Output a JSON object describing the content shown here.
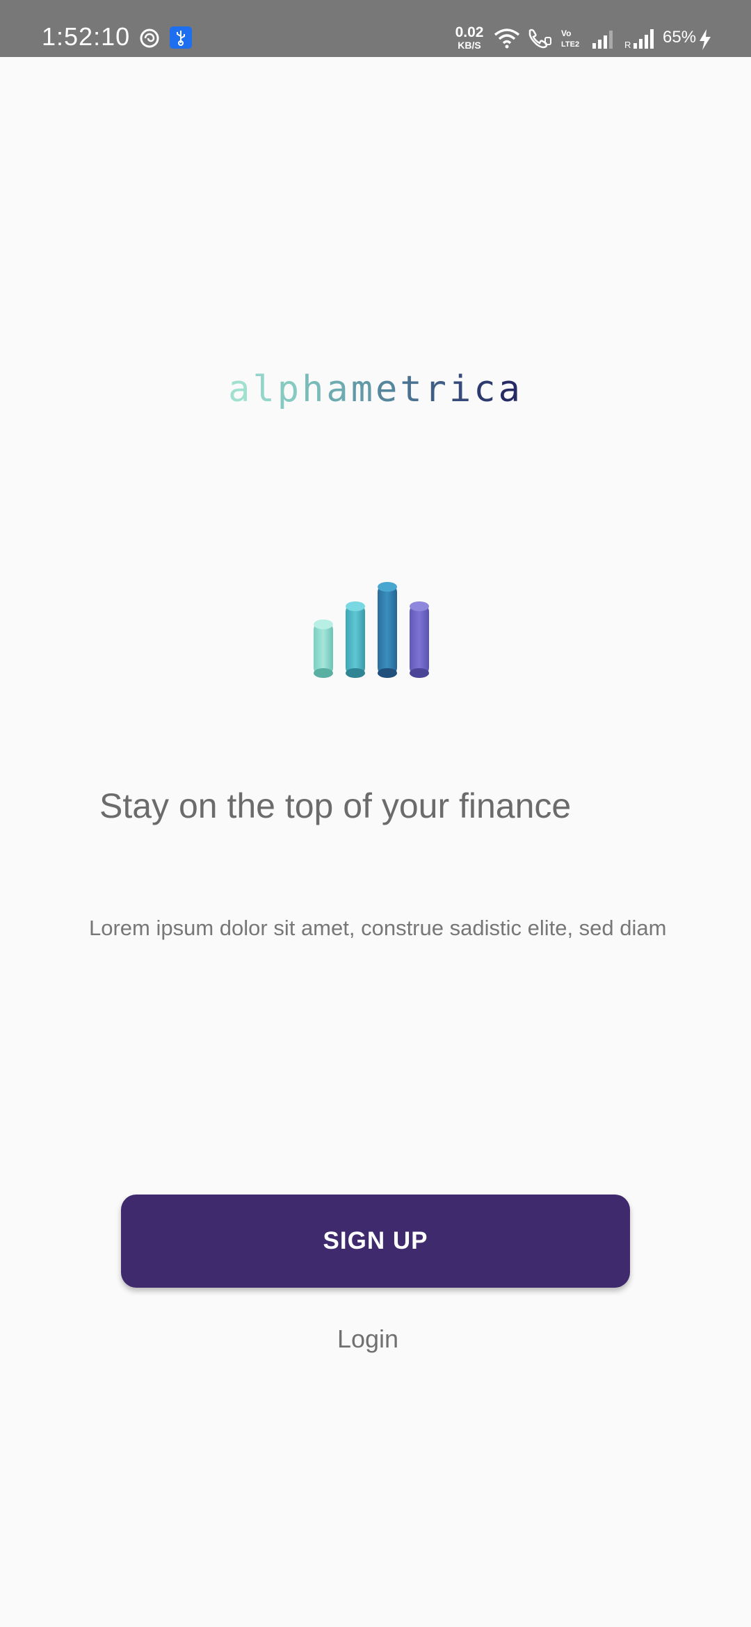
{
  "status_bar": {
    "time": "1:52:10",
    "net_speed_value": "0.02",
    "net_speed_unit": "KB/S",
    "battery_percent": "65%",
    "icons": [
      "sync-app-icon",
      "usb-icon",
      "wifi-icon",
      "wifi-calling-icon",
      "volte-icon",
      "signal-icon-1",
      "roaming-signal-icon",
      "battery-charging-icon"
    ]
  },
  "brand": {
    "logo_text": "alphametrica",
    "logo_colors": [
      "#9fe0cf",
      "#93d6c9",
      "#86c9c0",
      "#79bbb8",
      "#6dabb0",
      "#6299a6",
      "#56869b",
      "#4b7290",
      "#405e85",
      "#364b79",
      "#2d3a6e",
      "#262b63"
    ],
    "bar_colors": [
      "#8fd9cc",
      "#4fbccd",
      "#2f7fb0",
      "#6f64c4"
    ]
  },
  "content": {
    "headline": "Stay on the top of your finance",
    "subtext": "Lorem ipsum dolor sit amet, construe sadistic elite, sed diam"
  },
  "actions": {
    "signup_label": "SIGN UP",
    "login_label": "Login"
  },
  "colors": {
    "primary": "#3e2a6c",
    "background": "#fafafa",
    "status_bar": "#787878"
  }
}
